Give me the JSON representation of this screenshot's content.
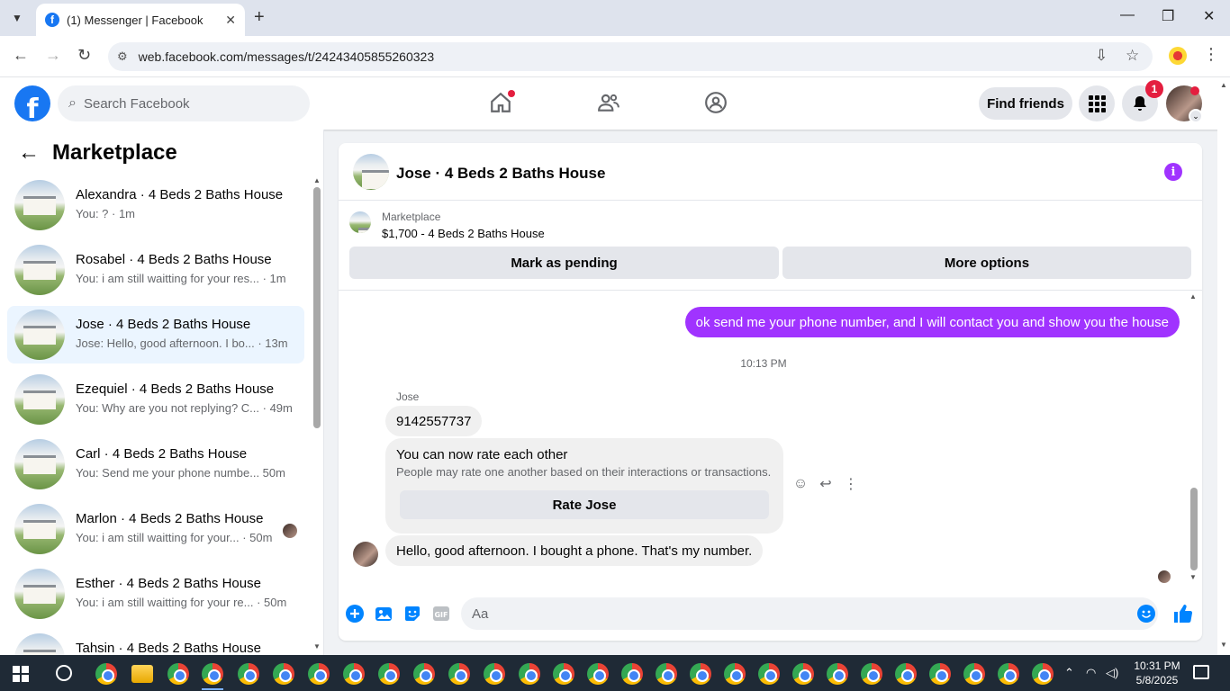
{
  "browser": {
    "tab_title": "(1) Messenger | Facebook",
    "url": "web.facebook.com/messages/t/24243405855260323"
  },
  "header": {
    "search_placeholder": "Search Facebook",
    "find_friends": "Find friends",
    "notifications_count": "1"
  },
  "sidebar": {
    "title": "Marketplace",
    "conversations": [
      {
        "name": "Alexandra · 4 Beds 2 Baths House",
        "preview": "You: ? · 1m"
      },
      {
        "name": "Rosabel · 4 Beds 2 Baths House",
        "preview": "You: i am still waitting for your res... · 1m"
      },
      {
        "name": "Jose · 4 Beds 2 Baths House",
        "preview": "Jose: Hello, good afternoon. I bo... · 13m"
      },
      {
        "name": "Ezequiel · 4 Beds 2 Baths House",
        "preview": "You: Why are you not replying? C... · 49m"
      },
      {
        "name": "Carl · 4 Beds 2 Baths House",
        "preview": "You: Send me your phone numbe... 50m"
      },
      {
        "name": "Marlon · 4 Beds 2 Baths House",
        "preview": "You: i am still waitting for your... · 50m"
      },
      {
        "name": "Esther · 4 Beds 2 Baths House",
        "preview": "You: i am still waitting for your re... · 50m"
      },
      {
        "name": "Tahsin · 4 Beds 2 Baths House",
        "preview": ""
      }
    ]
  },
  "chat": {
    "title": "Jose · 4 Beds 2 Baths House",
    "marketplace_label": "Marketplace",
    "listing": "$1,700 - 4 Beds 2 Baths House",
    "mark_pending": "Mark as pending",
    "more_options": "More options",
    "outgoing_message": "ok send me your phone number, and I will contact you and show you the house",
    "timestamp": "10:13 PM",
    "sender_name": "Jose",
    "phone_message": "9142557737",
    "rate_title": "You can now rate each other",
    "rate_subtitle": "People may rate one another based on their interactions or transactions.",
    "rate_button": "Rate Jose",
    "last_message": "Hello, good afternoon. I bought a phone. That's my number.",
    "composer_placeholder": "Aa"
  },
  "taskbar": {
    "time": "10:31 PM",
    "date": "5/8/2025"
  },
  "colors": {
    "fb_blue": "#1877f2",
    "messenger_purple": "#a033ff",
    "active_item": "#ebf5ff"
  }
}
